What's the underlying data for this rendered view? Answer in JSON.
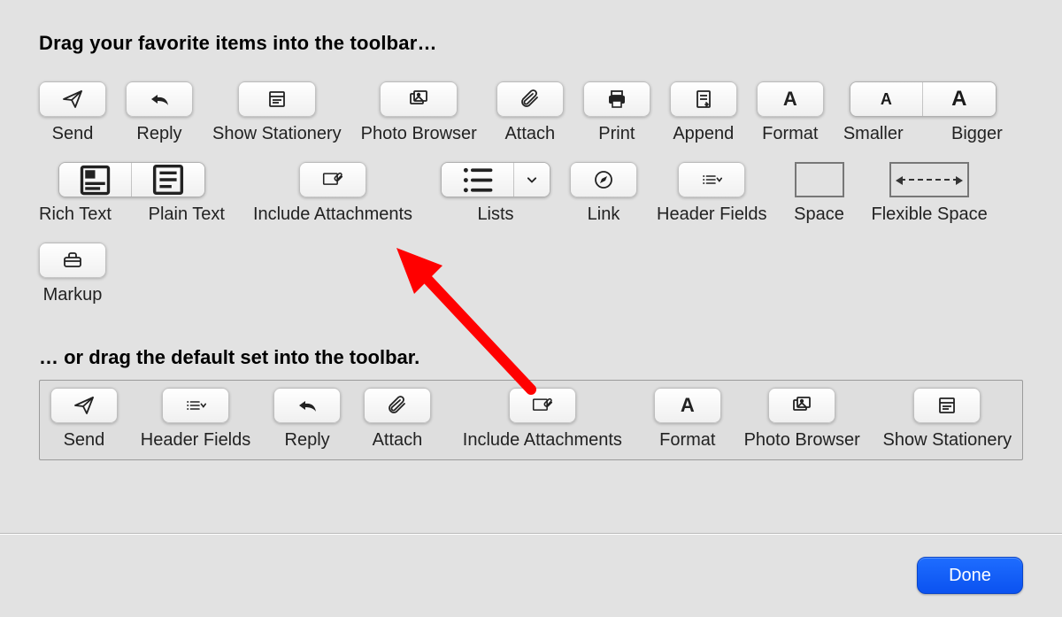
{
  "headings": {
    "favorites": "Drag your favorite items into the toolbar…",
    "defaults": "… or drag the default set into the toolbar."
  },
  "palette": {
    "row1": {
      "send": "Send",
      "reply": "Reply",
      "show_stationery": "Show Stationery",
      "photo_browser": "Photo Browser",
      "attach": "Attach",
      "print": "Print",
      "append": "Append",
      "format": "Format",
      "smaller": "Smaller",
      "bigger": "Bigger"
    },
    "row2": {
      "rich_text": "Rich Text",
      "plain_text": "Plain Text",
      "include_attachments": "Include Attachments",
      "lists": "Lists",
      "link": "Link",
      "header_fields": "Header Fields",
      "space": "Space",
      "flexible_space": "Flexible Space"
    },
    "row3": {
      "markup": "Markup"
    }
  },
  "defaults": {
    "send": "Send",
    "header_fields": "Header Fields",
    "reply": "Reply",
    "attach": "Attach",
    "include_attachments": "Include Attachments",
    "format": "Format",
    "photo_browser": "Photo Browser",
    "show_stationery": "Show Stationery"
  },
  "footer": {
    "done": "Done"
  },
  "glyphs": {
    "format_letter": "A"
  }
}
